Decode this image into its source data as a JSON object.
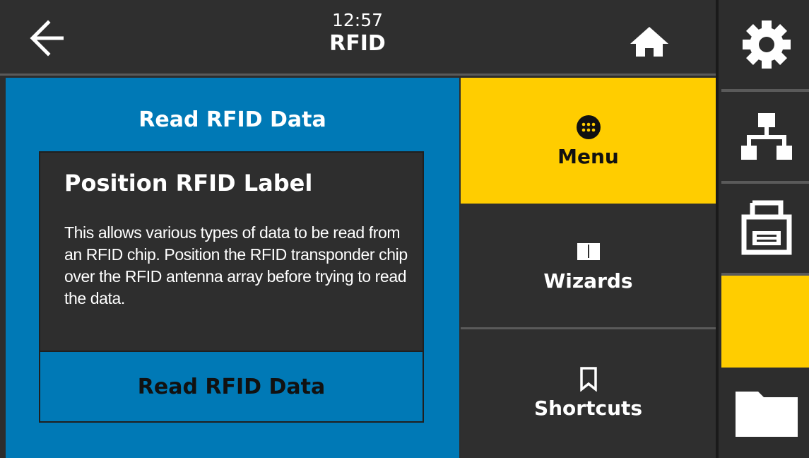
{
  "header": {
    "time": "12:57",
    "title": "RFID",
    "back_icon": "arrow-left-icon",
    "home_icon": "home-icon"
  },
  "panel": {
    "heading": "Read RFID Data",
    "card_title": "Position RFID Label",
    "card_body": "This allows various types of data to be read from an RFID chip. Position the RFID transponder chip over the RFID antenna array before trying to read the data.",
    "action_label": "Read RFID Data"
  },
  "nav": {
    "items": [
      {
        "label": "Menu",
        "icon": "grid-dots-icon",
        "active": true
      },
      {
        "label": "Wizards",
        "icon": "book-icon",
        "active": false
      },
      {
        "label": "Shortcuts",
        "icon": "bookmark-icon",
        "active": false
      }
    ]
  },
  "rail": {
    "items": [
      {
        "icon": "gear-icon"
      },
      {
        "icon": "network-icon"
      },
      {
        "icon": "printer-icon"
      },
      {
        "icon": "",
        "active": true
      },
      {
        "icon": "folder-icon"
      }
    ]
  },
  "colors": {
    "accent_yellow": "#ffcd00",
    "panel_blue": "#0079b6",
    "dark_bg": "#2d2d2d"
  }
}
